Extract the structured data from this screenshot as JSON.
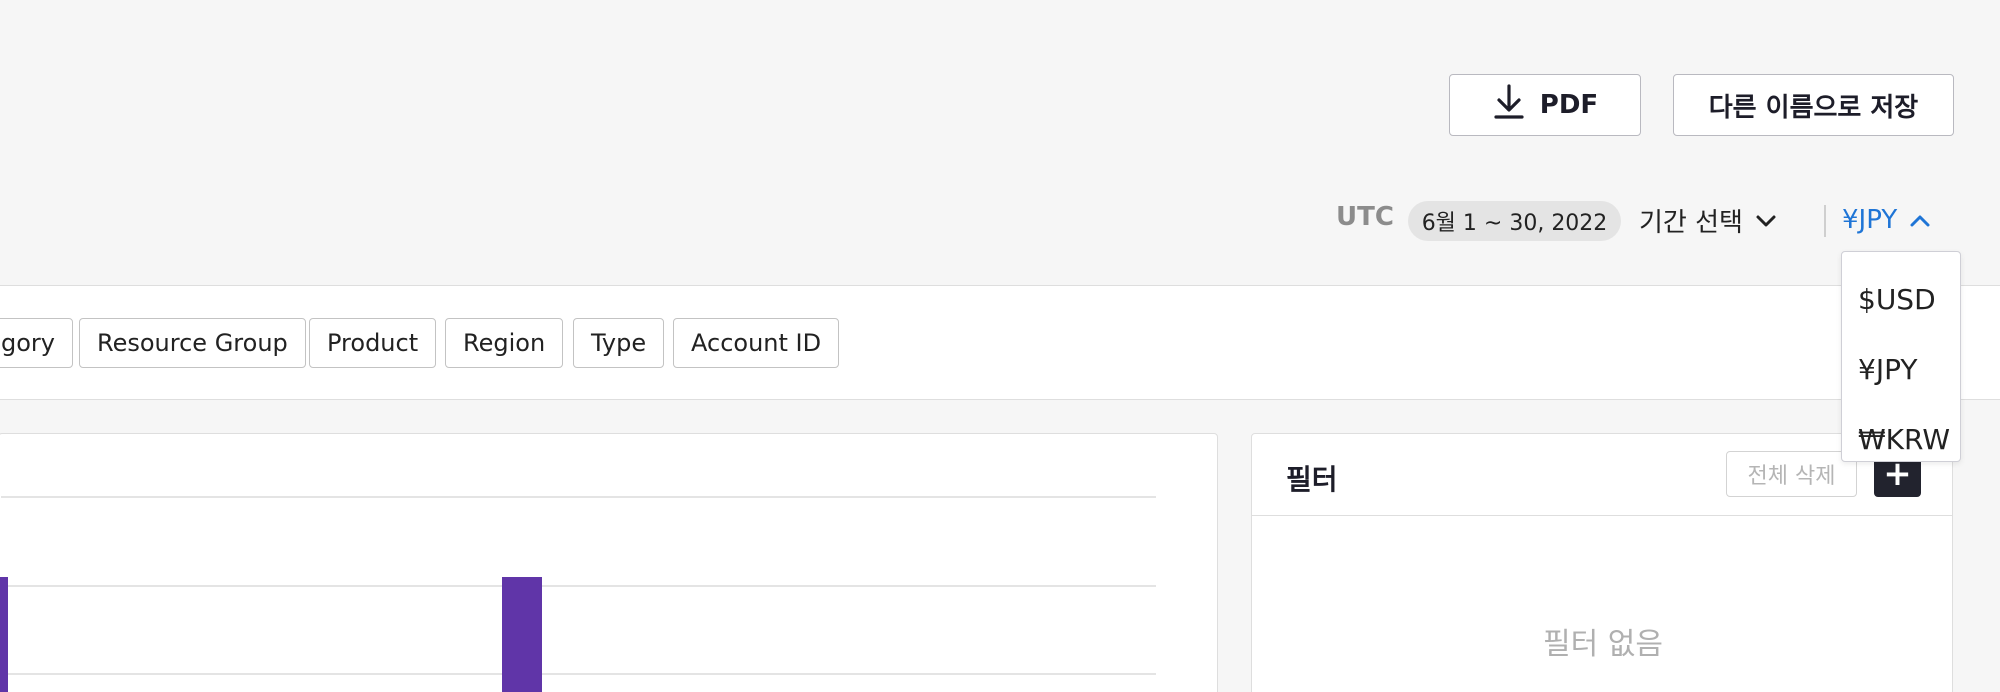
{
  "toolbar": {
    "pdf_label": "PDF",
    "save_as_label": "다른 이름으로 저장"
  },
  "date_range": {
    "timezone": "UTC",
    "range": "6월 1 ~ 30, 2022",
    "period_select_label": "기간 선택"
  },
  "currency": {
    "selected": "¥JPY",
    "options": [
      "$USD",
      "¥JPY",
      "₩KRW"
    ],
    "accent_color": "#1f75d6"
  },
  "group_by": {
    "chips": [
      "gory",
      "Resource Group",
      "Product",
      "Region",
      "Type",
      "Account ID"
    ]
  },
  "chart": {
    "bar_color": "#6035a8"
  },
  "filters": {
    "title": "필터",
    "clear_all_label": "전체 삭제",
    "add_icon": "plus-icon",
    "empty_text": "필터 없음"
  }
}
